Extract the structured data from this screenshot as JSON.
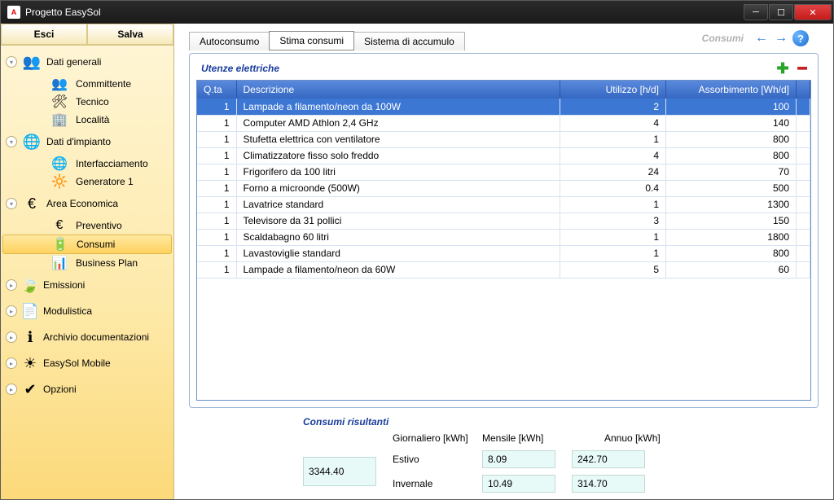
{
  "window": {
    "title": "Progetto EasySol"
  },
  "toolbar": {
    "esci": "Esci",
    "salva": "Salva"
  },
  "sidebar": {
    "groups": [
      {
        "label": "Dati generali",
        "icon": "👥",
        "items": [
          {
            "label": "Committente",
            "icon": "👥"
          },
          {
            "label": "Tecnico",
            "icon": "🛠"
          },
          {
            "label": "Località",
            "icon": "🏢"
          }
        ]
      },
      {
        "label": "Dati d'impianto",
        "icon": "🌐",
        "items": [
          {
            "label": "Interfacciamento",
            "icon": "🌐"
          },
          {
            "label": "Generatore 1",
            "icon": "🔆"
          }
        ]
      },
      {
        "label": "Area Economica",
        "icon": "€",
        "items": [
          {
            "label": "Preventivo",
            "icon": "€"
          },
          {
            "label": "Consumi",
            "icon": "🔋",
            "active": true
          },
          {
            "label": "Business Plan",
            "icon": "📊"
          }
        ]
      },
      {
        "label": "Emissioni",
        "icon": "🍃"
      },
      {
        "label": "Modulistica",
        "icon": "📄"
      },
      {
        "label": "Archivio documentazioni",
        "icon": "ℹ"
      },
      {
        "label": "EasySol Mobile",
        "icon": "☀"
      },
      {
        "label": "Opzioni",
        "icon": "✔"
      }
    ]
  },
  "tabs": {
    "items": [
      "Autoconsumo",
      "Stima consumi",
      "Sistema di accumulo"
    ],
    "active": 1,
    "right_label": "Consumi"
  },
  "panel": {
    "title": "Utenze elettriche"
  },
  "table": {
    "headers": {
      "qta": "Q.ta",
      "desc": "Descrizione",
      "util": "Utilizzo [h/d]",
      "ass": "Assorbimento [Wh/d]"
    },
    "rows": [
      {
        "qta": "1",
        "desc": "Lampade a filamento/neon da 100W",
        "util": "2",
        "ass": "100",
        "selected": true
      },
      {
        "qta": "1",
        "desc": "Computer AMD Athlon 2,4 GHz",
        "util": "4",
        "ass": "140"
      },
      {
        "qta": "1",
        "desc": "Stufetta elettrica con ventilatore",
        "util": "1",
        "ass": "800"
      },
      {
        "qta": "1",
        "desc": "Climatizzatore fisso solo freddo",
        "util": "4",
        "ass": "800"
      },
      {
        "qta": "1",
        "desc": "Frigorifero da 100 litri",
        "util": "24",
        "ass": "70"
      },
      {
        "qta": "1",
        "desc": "Forno a microonde (500W)",
        "util": "0.4",
        "ass": "500"
      },
      {
        "qta": "1",
        "desc": "Lavatrice standard",
        "util": "1",
        "ass": "1300"
      },
      {
        "qta": "1",
        "desc": "Televisore da 31 pollici",
        "util": "3",
        "ass": "150"
      },
      {
        "qta": "1",
        "desc": "Scaldabagno 60 litri",
        "util": "1",
        "ass": "1800"
      },
      {
        "qta": "1",
        "desc": "Lavastoviglie standard",
        "util": "1",
        "ass": "800"
      },
      {
        "qta": "1",
        "desc": "Lampade a filamento/neon da 60W",
        "util": "5",
        "ass": "60"
      }
    ]
  },
  "results": {
    "title": "Consumi risultanti",
    "headers": {
      "daily": "Giornaliero [kWh]",
      "monthly": "Mensile [kWh]",
      "yearly": "Annuo [kWh]"
    },
    "rows": {
      "summer": {
        "label": "Estivo",
        "daily": "8.09",
        "monthly": "242.70"
      },
      "winter": {
        "label": "Invernale",
        "daily": "10.49",
        "monthly": "314.70"
      }
    },
    "yearly": "3344.40"
  }
}
